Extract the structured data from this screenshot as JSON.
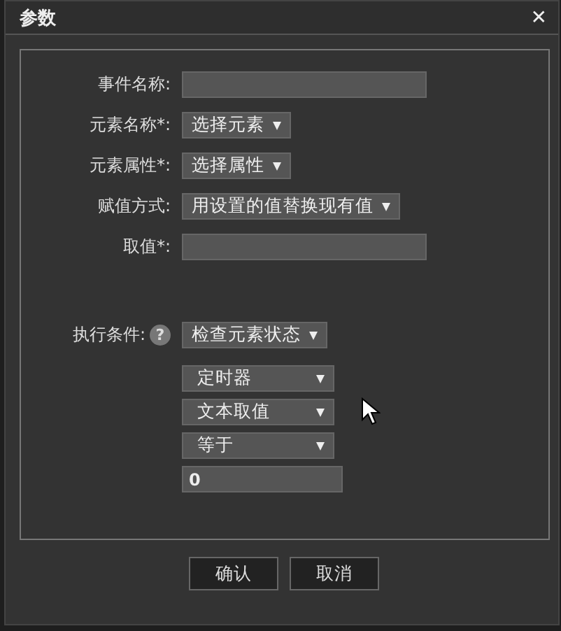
{
  "window": {
    "title": "参数",
    "close": "✕"
  },
  "fields": [
    {
      "label": "事件名称:",
      "kind": "text"
    },
    {
      "label": "元素名称*:",
      "kind": "select",
      "value": "选择元素"
    },
    {
      "label": "元素属性*:",
      "kind": "select",
      "value": "选择属性"
    },
    {
      "label": "赋值方式:",
      "kind": "select",
      "value": "用设置的值替换现有值"
    },
    {
      "label": "取值*:",
      "kind": "text"
    }
  ],
  "condition": {
    "label": "执行条件:",
    "help": "?",
    "value": "检查元素状态",
    "sub_fields": [
      {
        "kind": "select",
        "value": "定时器"
      },
      {
        "kind": "select",
        "value": "文本取值"
      },
      {
        "kind": "select",
        "value": "等于"
      },
      {
        "kind": "text",
        "value": "0"
      }
    ]
  },
  "buttons": [
    "确认",
    "取消"
  ]
}
